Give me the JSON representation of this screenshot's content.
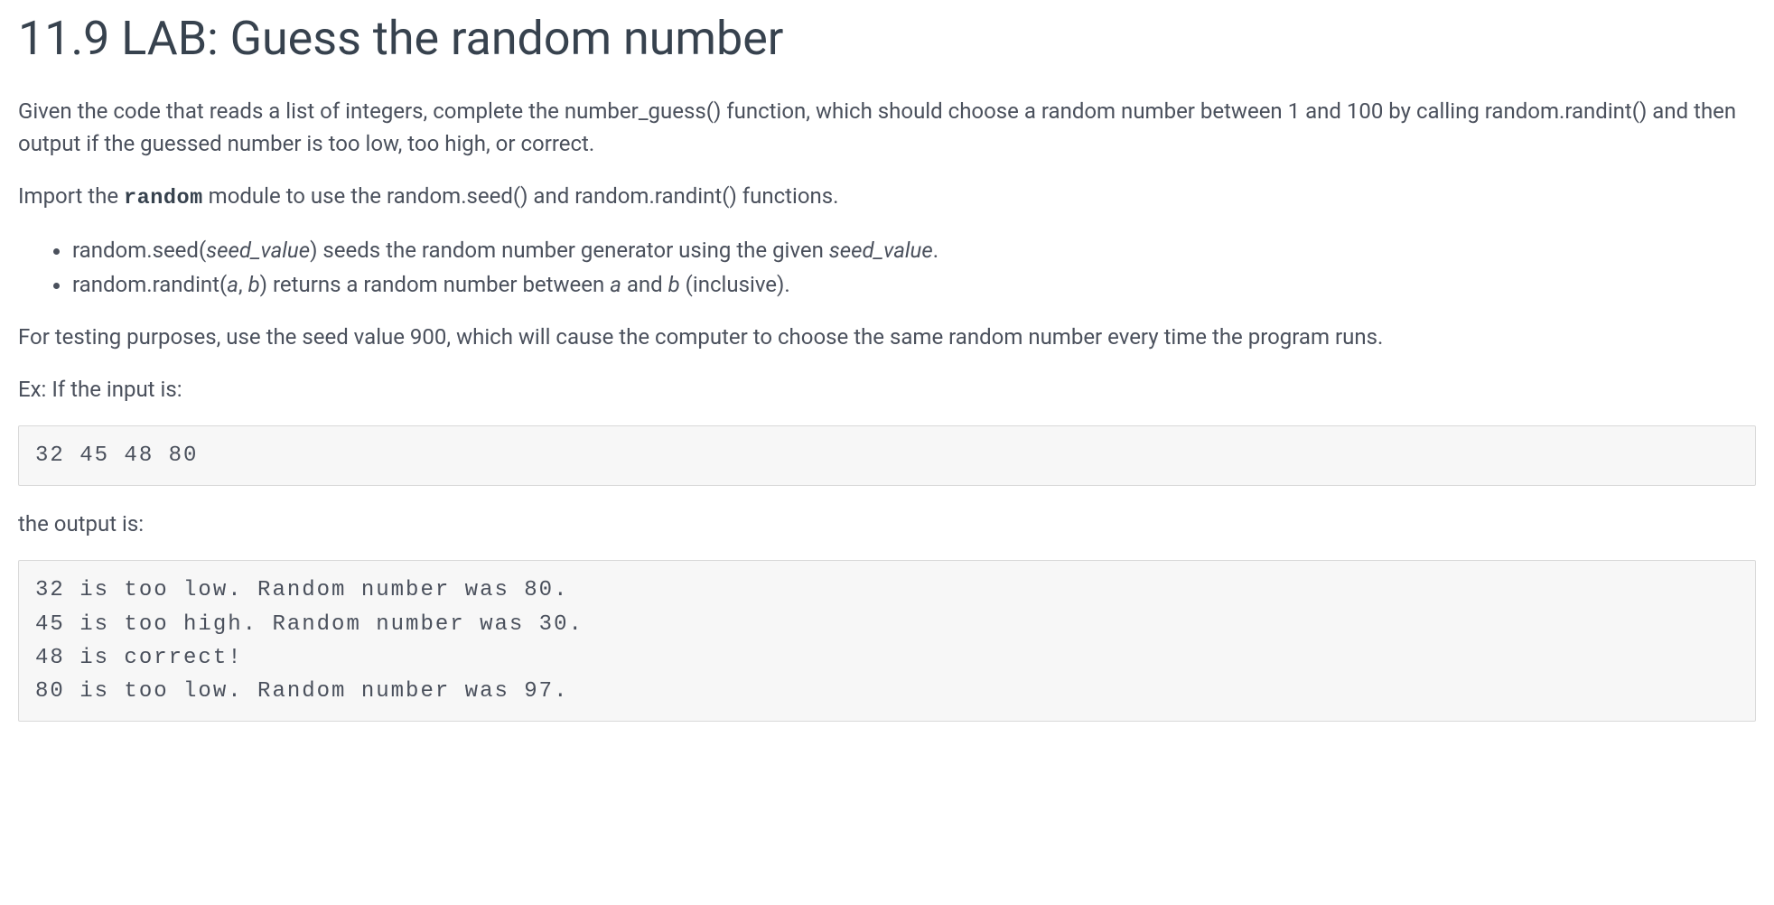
{
  "title": "11.9 LAB: Guess the random number",
  "paragraphs": {
    "intro": "Given the code that reads a list of integers, complete the number_guess() function, which should choose a random number between 1 and 100 by calling random.randint() and then output if the guessed number is too low, too high, or correct.",
    "import_prefix": "Import the ",
    "import_code": "random",
    "import_suffix": " module to use the random.seed() and random.randint() functions.",
    "testing": "For testing purposes, use the seed value 900, which will cause the computer to choose the same random number every time the program runs.",
    "ex_label": "Ex: If the input is:",
    "output_label": "the output is:"
  },
  "bullets": {
    "seed": {
      "prefix": "random.seed(",
      "arg": "seed_value",
      "mid": ") seeds the random number generator using the given ",
      "arg2": "seed_value",
      "suffix": "."
    },
    "randint": {
      "prefix": "random.randint(",
      "arg_a": "a",
      "comma": ", ",
      "arg_b": "b",
      "mid": ") returns a random number between ",
      "arg_a2": "a",
      "and": " and ",
      "arg_b2": "b",
      "suffix": " (inclusive)."
    }
  },
  "code": {
    "input": "32 45 48 80",
    "output": "32 is too low. Random number was 80.\n45 is too high. Random number was 30.\n48 is correct!\n80 is too low. Random number was 97."
  }
}
